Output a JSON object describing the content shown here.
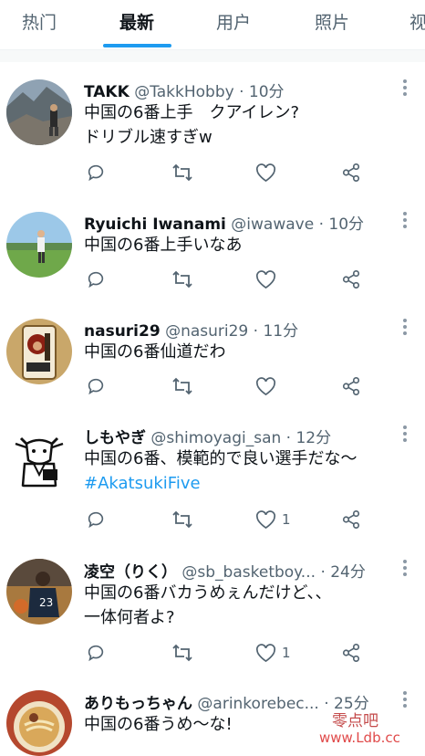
{
  "tabs": [
    {
      "label": "热门",
      "active": false
    },
    {
      "label": "最新",
      "active": true
    },
    {
      "label": "用户",
      "active": false
    },
    {
      "label": "照片",
      "active": false
    },
    {
      "label": "视",
      "active": false
    }
  ],
  "tweets": [
    {
      "name": "TAKK",
      "handle": "@TakkHobby",
      "time": "· 10分",
      "lines": [
        "中国の6番上手　クアイレン?",
        "ドリブル速すぎw"
      ],
      "hashtag": "",
      "likes": "",
      "avatar": "mountain-photo"
    },
    {
      "name": "Ryuichi Iwanami",
      "handle": "@iwawave",
      "time": "· 10分",
      "lines": [
        "中国の6番上手いなあ"
      ],
      "hashtag": "",
      "likes": "",
      "avatar": "field-photo"
    },
    {
      "name": "nasuri29",
      "handle": "@nasuri29",
      "time": "· 11分",
      "lines": [
        "中国の6番仙道だわ"
      ],
      "hashtag": "",
      "likes": "",
      "avatar": "tag-photo"
    },
    {
      "name": "しもやぎ",
      "handle": "@shimoyagi_san",
      "time": "· 12分",
      "lines": [
        "中国の6番、模範的で良い選手だな〜"
      ],
      "hashtag": "#AkatsukiFive",
      "likes": "1",
      "avatar": "goat-drawing"
    },
    {
      "name": "凌空（りく）",
      "handle": "@sb_basketboy...",
      "time": "· 24分",
      "lines": [
        "中国の6番バカうめぇんだけど、、",
        "一体何者よ?"
      ],
      "hashtag": "",
      "likes": "1",
      "avatar": "basketball-photo"
    },
    {
      "name": "ありもっちゃん",
      "handle": "@arinkorebec...",
      "time": "· 25分",
      "lines": [
        "中国の6番うめ〜な!"
      ],
      "hashtag": "",
      "likes": "",
      "avatar": "ramen-photo"
    }
  ],
  "icons": {
    "reply": "reply-icon",
    "retweet": "retweet-icon",
    "like": "like-icon",
    "share": "share-icon",
    "more": "more-icon"
  },
  "colors": {
    "accent": "#1d9bf0",
    "secondary_text": "#536471",
    "divider": "#eff3f4"
  },
  "watermark": {
    "line1": "零点吧",
    "line2": "www.Ldb.cc"
  }
}
